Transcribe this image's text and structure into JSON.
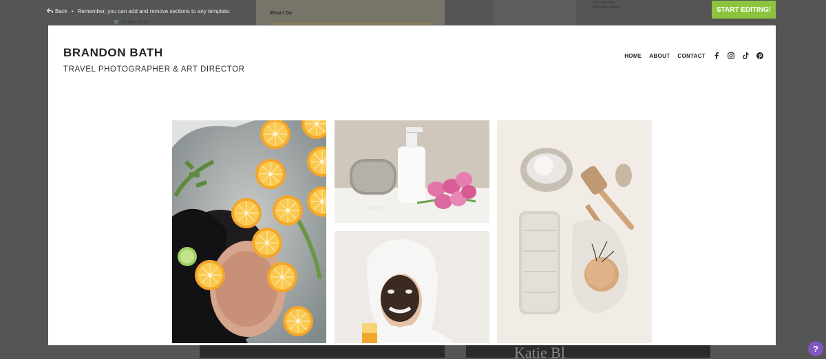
{
  "editor": {
    "back_label": "Back",
    "separator": "•",
    "tip_text": "Remember, you can add and remove sections to any template.",
    "start_editing_label": "START EDITING!",
    "help_label": "?"
  },
  "background": {
    "section_label": "What I Do",
    "store_label": "Online Store",
    "list_items": [
      "The Daily Post",
      "Bathroom Update"
    ],
    "bottom_text": "Katie Bl"
  },
  "site": {
    "title": "BRANDON BATH",
    "subtitle": "TRAVEL PHOTOGRAPHER & ART DIRECTOR",
    "nav": {
      "home": "HOME",
      "about": "ABOUT",
      "contact": "CONTACT"
    },
    "social_icons": [
      "facebook-icon",
      "instagram-icon",
      "tiktok-icon",
      "pinterest-icon"
    ]
  },
  "colors": {
    "overlay": "#555555",
    "accent_button": "#8dc43d",
    "help_button": "#7e57c2"
  }
}
